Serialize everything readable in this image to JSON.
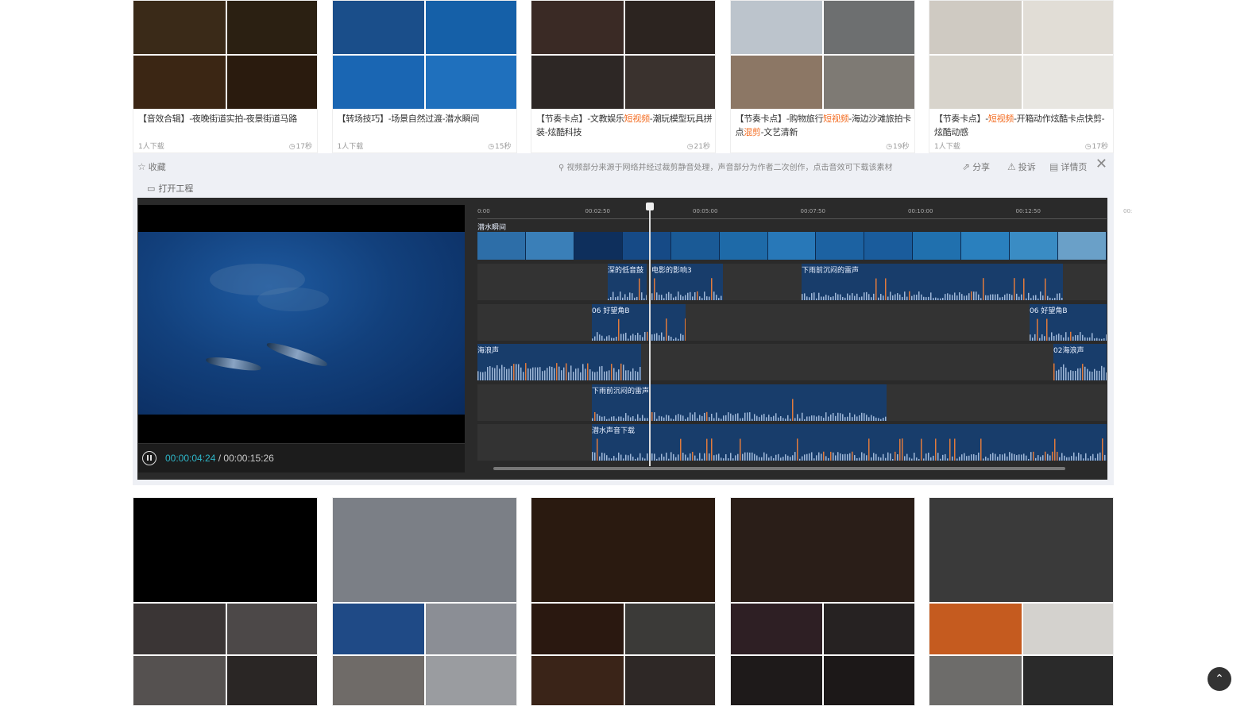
{
  "top_cards": [
    {
      "title_parts": [
        {
          "t": "【音效合辑】-夜晚街道实拍-夜景街道马路",
          "hl": false
        }
      ],
      "downloads": "1人下载",
      "duration": "17秒",
      "colors": [
        "#3a2a18",
        "#2b2012",
        "#3b2614",
        "#2a1b0e"
      ]
    },
    {
      "title_parts": [
        {
          "t": "【转场技巧】-场景自然过渡-潜水瞬间",
          "hl": false
        }
      ],
      "downloads": "1人下载",
      "duration": "15秒",
      "colors": [
        "#1a4e8a",
        "#1560a8",
        "#1a66b3",
        "#1f70bd"
      ]
    },
    {
      "title_parts": [
        {
          "t": "【节奏卡点】-文教娱乐",
          "hl": false
        },
        {
          "t": "短视频",
          "hl": true
        },
        {
          "t": "-潮玩模型玩具拼装-炫酷科技",
          "hl": false
        }
      ],
      "downloads": "",
      "duration": "21秒",
      "colors": [
        "#3a2a25",
        "#2c2420",
        "#2d2725",
        "#3a322e"
      ]
    },
    {
      "title_parts": [
        {
          "t": "【节奏卡点】-购物旅行",
          "hl": false
        },
        {
          "t": "短视频",
          "hl": true
        },
        {
          "t": "-海边沙滩旅拍卡点",
          "hl": false
        },
        {
          "t": "混剪",
          "hl": true
        },
        {
          "t": "-文艺清新",
          "hl": false
        }
      ],
      "downloads": "",
      "duration": "19秒",
      "colors": [
        "#bcc4cc",
        "#6d6f70",
        "#8c7765",
        "#7e7a74"
      ]
    },
    {
      "title_parts": [
        {
          "t": "【节奏卡点】-",
          "hl": false
        },
        {
          "t": "短视频",
          "hl": true
        },
        {
          "t": "-开箱动作炫酷卡点快剪-炫酷动感",
          "hl": false
        }
      ],
      "downloads": "1人下载",
      "duration": "17秒",
      "colors": [
        "#cfcac2",
        "#e1ddd6",
        "#d8d4cc",
        "#e8e6e1"
      ]
    }
  ],
  "detail": {
    "favorite_label": "收藏",
    "notice": "视频部分来源于网络并经过裁剪静音处理，声音部分为作者二次创作，点击音效可下载该素材",
    "share_label": "分享",
    "report_label": "投诉",
    "details_label": "详情页",
    "close_label": "✕",
    "open_project_label": "打开工程",
    "time_current": "00:00:04:24",
    "time_separator": " / ",
    "time_total": "00:00:15:26"
  },
  "timeline": {
    "ticks": [
      "0:00",
      "00:02:50",
      "00:05:00",
      "00:07:50",
      "00:10:00",
      "00:12:50",
      "00:"
    ],
    "video_track_label": "潜水瞬间",
    "tracks": [
      {
        "clips": [
          {
            "label": "深的低音鼓",
            "start": 164,
            "end": 213
          },
          {
            "label": "电影的影响3",
            "start": 219,
            "end": 309
          },
          {
            "label": "下雨前沉闷的雷声",
            "start": 408,
            "end": 737
          }
        ]
      },
      {
        "clips": [
          {
            "label": "06 好望角B",
            "start": 144,
            "end": 262
          },
          {
            "label": "06 好望角B",
            "start": 695,
            "end": 792
          }
        ]
      },
      {
        "clips": [
          {
            "label": "海浪声",
            "start": 0,
            "end": 206
          },
          {
            "label": "02海浪声",
            "start": 725,
            "end": 792
          }
        ]
      },
      {
        "clips": [
          {
            "label": "下雨前沉闷的雷声",
            "start": 144,
            "end": 515
          }
        ]
      },
      {
        "clips": [
          {
            "label": "潜水声音下载",
            "start": 144,
            "end": 792
          }
        ]
      }
    ]
  },
  "bottom_cards": [
    {
      "main": "#000000",
      "colors": [
        "#3a3535",
        "#4c4848",
        "#555150",
        "#2a2625"
      ]
    },
    {
      "main": "#7b7f86",
      "colors": [
        "#1f4a86",
        "#8b8e95",
        "#6f6b68",
        "#9a9ca0"
      ]
    },
    {
      "main": "#2a1a10",
      "colors": [
        "#2a1810",
        "#3b3a38",
        "#3a2418",
        "#2e2826"
      ]
    },
    {
      "main": "#2a1e18",
      "colors": [
        "#2e1f24",
        "#262222",
        "#1e1a1a",
        "#1c1818"
      ]
    },
    {
      "main": "#3a3a3a",
      "colors": [
        "#c55b1f",
        "#d4d2ce",
        "#6d6c6a",
        "#2a2a2a"
      ]
    }
  ],
  "back_to_top_icon": "chevron-up-icon"
}
